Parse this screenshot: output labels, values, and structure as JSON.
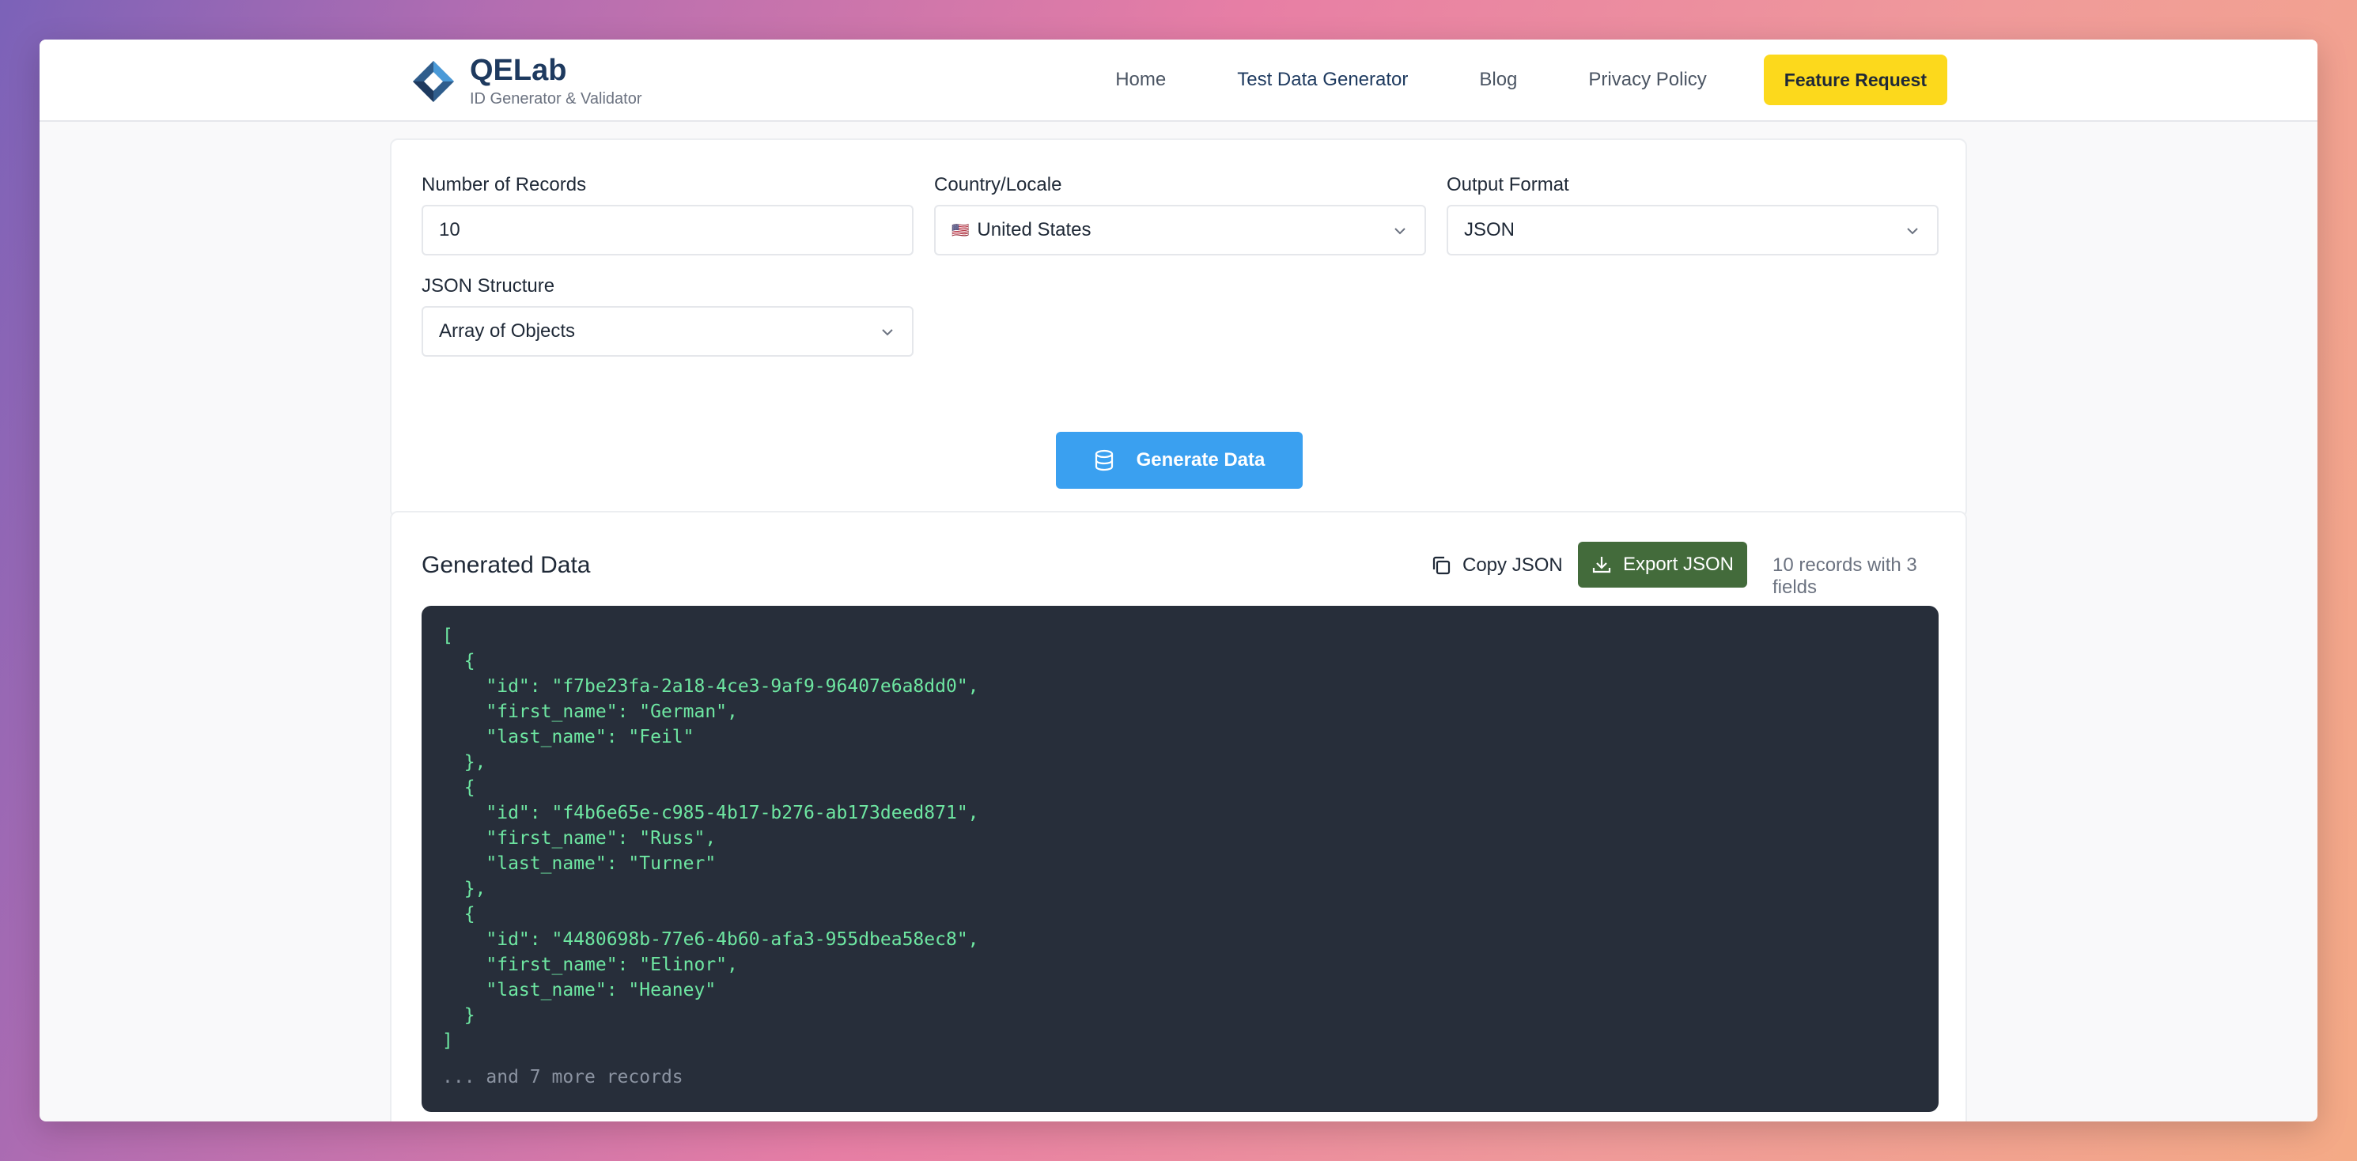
{
  "brand": {
    "title": "QELab",
    "subtitle": "ID Generator & Validator"
  },
  "nav": {
    "items": [
      "Home",
      "Test Data Generator",
      "Blog",
      "Privacy Policy"
    ],
    "active": "Test Data Generator",
    "feature_button": "Feature Request"
  },
  "form": {
    "records": {
      "label": "Number of Records",
      "value": "10"
    },
    "country": {
      "label": "Country/Locale",
      "flag": "🇺🇸",
      "value": "United States"
    },
    "format": {
      "label": "Output Format",
      "value": "JSON"
    },
    "structure": {
      "label": "JSON Structure",
      "value": "Array of Objects"
    },
    "generate_button": "Generate Data"
  },
  "output": {
    "title": "Generated Data",
    "copy_button": "Copy JSON",
    "export_button": "Export JSON",
    "records_info": "10 records with 3 fields",
    "code": "[\n  {\n    \"id\": \"f7be23fa-2a18-4ce3-9af9-96407e6a8dd0\",\n    \"first_name\": \"German\",\n    \"last_name\": \"Feil\"\n  },\n  {\n    \"id\": \"f4b6e65e-c985-4b17-b276-ab173deed871\",\n    \"first_name\": \"Russ\",\n    \"last_name\": \"Turner\"\n  },\n  {\n    \"id\": \"4480698b-77e6-4b60-afa3-955dbea58ec8\",\n    \"first_name\": \"Elinor\",\n    \"last_name\": \"Heaney\"\n  }\n]",
    "more_text": "... and 7 more records"
  },
  "colors": {
    "brand_navy": "#1e3a5f",
    "feature_yellow": "#fcd91c",
    "generate_blue": "#3aa0f0",
    "export_green": "#436b3b",
    "code_bg": "#272e3a",
    "code_text": "#6ee7a2"
  },
  "icons": [
    "qelab-logo-icon",
    "chevron-down-icon",
    "database-icon",
    "copy-icon",
    "download-icon"
  ]
}
